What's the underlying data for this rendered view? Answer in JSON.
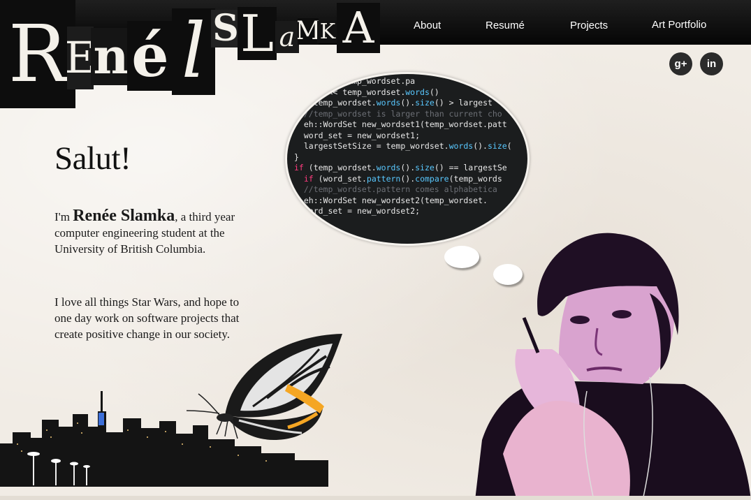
{
  "logo": {
    "first_name_letters": [
      "R",
      "E",
      "n",
      "é",
      "l"
    ],
    "last_name_letters": [
      "S",
      "L",
      "a",
      "M",
      "K",
      "A"
    ]
  },
  "nav": {
    "items": [
      "About",
      "Resumé",
      "Projects",
      "Art Portfolio"
    ]
  },
  "social": {
    "google_plus_label": "g+",
    "linkedin_label": "in"
  },
  "main": {
    "greeting": "Salut!",
    "intro_prefix": "I'm",
    "intro_name": "Renée Slamka",
    "intro_suffix": ", a third year computer engineering student at the University of British Columbia.",
    "bio": "I love all things Star Wars, and hope to one day work on software projects that create positive change in our society."
  },
  "thought_bubble": {
    "code_lines": [
      "  cerr << temp_wordset.pa",
      "  cerr << temp_wordset.words()",
      "if (temp_wordset.words().size() > largest",
      "  //temp_wordset is larger than current cho",
      "  eh::WordSet new_wordset1(temp_wordset.patt",
      "  word_set = new_wordset1;",
      "  largestSetSize = temp_wordset.words().size(",
      "}",
      "if (temp_wordset.words().size() == largestSe",
      "  if (word_set.pattern().compare(temp_words",
      "  //temp_wordset.pattern comes alphabetica",
      "  eh::WordSet new_wordset2(temp_wordset.",
      "  word_set = new_wordset2;"
    ]
  },
  "colors": {
    "nav_bg": "#0a0a0a",
    "paper_bg": "#f1ece5",
    "accent_purple": "#8a2f8f",
    "accent_pink": "#e7a8d4"
  }
}
